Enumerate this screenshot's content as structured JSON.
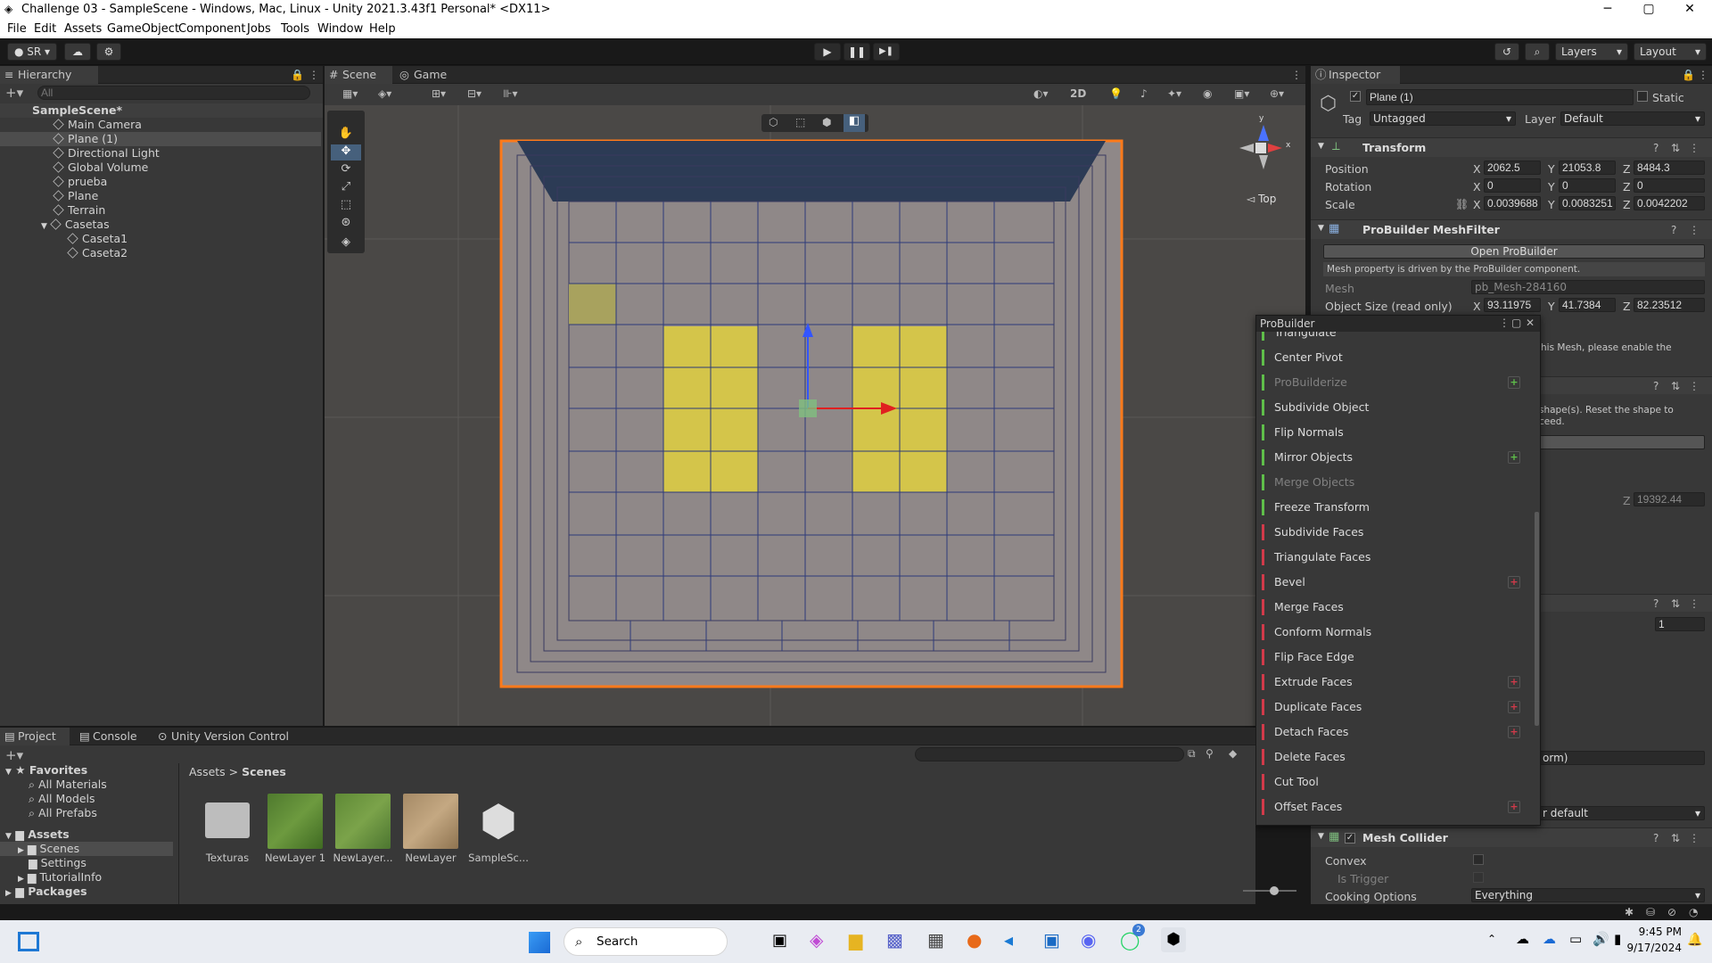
{
  "window": {
    "title": "Challenge 03 - SampleScene - Windows, Mac, Linux - Unity 2021.3.43f1 Personal* <DX11>",
    "min": "─",
    "max": "▢",
    "close": "✕"
  },
  "menu": [
    "File",
    "Edit",
    "Assets",
    "GameObject",
    "Component",
    "Jobs",
    "Tools",
    "Window",
    "Help"
  ],
  "toolbar": {
    "account": "SR",
    "layers": "Layers",
    "layout": "Layout",
    "play": "▶",
    "pause": "❚❚",
    "step": "▶❚"
  },
  "hierarchy": {
    "tab": "Hierarchy",
    "search_placeholder": "All",
    "scene": "SampleScene*",
    "items": [
      "Main Camera",
      "Plane (1)",
      "Directional Light",
      "Global Volume",
      "prueba",
      "Plane",
      "Terrain",
      "Casetas",
      "Caseta1",
      "Caseta2"
    ]
  },
  "scene": {
    "tab_scene": "Scene",
    "tab_game": "Game",
    "btn_2d": "2D",
    "view_label": "Top",
    "gizmo_y": "y",
    "gizmo_x": "x"
  },
  "inspector": {
    "tab": "Inspector",
    "object_name": "Plane (1)",
    "static_label": "Static",
    "tag_label": "Tag",
    "tag_value": "Untagged",
    "layer_label": "Layer",
    "layer_value": "Default",
    "transform": {
      "title": "Transform",
      "position_label": "Position",
      "rotation_label": "Rotation",
      "scale_label": "Scale",
      "pos": {
        "x": "2062.5",
        "y": "21053.8",
        "z": "8484.3"
      },
      "rot": {
        "x": "0",
        "y": "0",
        "z": "0"
      },
      "scale": {
        "x": "0.0039688",
        "y": "0.0083251",
        "z": "0.0042202"
      }
    },
    "meshfilter": {
      "title": "ProBuilder MeshFilter",
      "open_button": "Open ProBuilder",
      "info": "Mesh property is driven by the ProBuilder component.",
      "mesh_label": "Mesh",
      "mesh_value": "pb_Mesh-284160",
      "size_label": "Object Size (read only)",
      "size": {
        "x": "93.11975",
        "y": "41.7384",
        "z": "82.23512"
      }
    },
    "partial1": "his Mesh, please enable the",
    "partial2": "shape(s). Reset the shape to",
    "partial3": "ceed.",
    "partial_z": "19392.44",
    "partial_one": "1",
    "partial_orm": "orm)",
    "partial_default": "r default",
    "meshcollider": {
      "title": "Mesh Collider",
      "convex_label": "Convex",
      "trigger_label": "Is Trigger",
      "cooking_label": "Cooking Options",
      "cooking_value": "Everything"
    },
    "axis": {
      "x": "X",
      "y": "Y",
      "z": "Z"
    }
  },
  "probuilder": {
    "title": "ProBuilder",
    "items": [
      {
        "label": "Triangulate",
        "color": "#5fbf4a",
        "disabled": false,
        "plus": false
      },
      {
        "label": "Center Pivot",
        "color": "#5fbf4a",
        "disabled": false,
        "plus": false
      },
      {
        "label": "ProBuilderize",
        "color": "#5fbf4a",
        "disabled": true,
        "plus": true
      },
      {
        "label": "Subdivide Object",
        "color": "#5fbf4a",
        "disabled": false,
        "plus": false
      },
      {
        "label": "Flip Normals",
        "color": "#5fbf4a",
        "disabled": false,
        "plus": false
      },
      {
        "label": "Mirror Objects",
        "color": "#5fbf4a",
        "disabled": false,
        "plus": true
      },
      {
        "label": "Merge Objects",
        "color": "#5fbf4a",
        "disabled": true,
        "plus": false
      },
      {
        "label": "Freeze Transform",
        "color": "#5fbf4a",
        "disabled": false,
        "plus": false
      },
      {
        "label": "Subdivide Faces",
        "color": "#d23a4a",
        "disabled": false,
        "plus": false
      },
      {
        "label": "Triangulate Faces",
        "color": "#d23a4a",
        "disabled": false,
        "plus": false
      },
      {
        "label": "Bevel",
        "color": "#d23a4a",
        "disabled": false,
        "plus": true
      },
      {
        "label": "Merge Faces",
        "color": "#d23a4a",
        "disabled": false,
        "plus": false
      },
      {
        "label": "Conform Normals",
        "color": "#d23a4a",
        "disabled": false,
        "plus": false
      },
      {
        "label": "Flip Face Edge",
        "color": "#d23a4a",
        "disabled": false,
        "plus": false
      },
      {
        "label": "Extrude Faces",
        "color": "#d23a4a",
        "disabled": false,
        "plus": true
      },
      {
        "label": "Duplicate Faces",
        "color": "#d23a4a",
        "disabled": false,
        "plus": true
      },
      {
        "label": "Detach Faces",
        "color": "#d23a4a",
        "disabled": false,
        "plus": true
      },
      {
        "label": "Delete Faces",
        "color": "#d23a4a",
        "disabled": false,
        "plus": false
      },
      {
        "label": "Cut Tool",
        "color": "#d23a4a",
        "disabled": false,
        "plus": false
      },
      {
        "label": "Offset Faces",
        "color": "#d23a4a",
        "disabled": false,
        "plus": true
      }
    ]
  },
  "project": {
    "tab_project": "Project",
    "tab_console": "Console",
    "tab_vc": "Unity Version Control",
    "favorites": "Favorites",
    "fav_items": [
      "All Materials",
      "All Models",
      "All Prefabs"
    ],
    "assets": "Assets",
    "asset_items": [
      "Scenes",
      "Settings",
      "TutorialInfo"
    ],
    "packages": "Packages",
    "crumb1": "Assets",
    "crumb_sep": ">",
    "crumb2": "Scenes",
    "files": [
      {
        "name": "Texturas",
        "kind": "folder"
      },
      {
        "name": "NewLayer 1",
        "kind": "grass"
      },
      {
        "name": "NewLayer...",
        "kind": "grass"
      },
      {
        "name": "NewLayer",
        "kind": "dirt"
      },
      {
        "name": "SampleSc...",
        "kind": "unity"
      }
    ]
  },
  "taskbar": {
    "search": "Search",
    "time": "9:45 PM",
    "date": "9/17/2024",
    "badge": "2"
  }
}
